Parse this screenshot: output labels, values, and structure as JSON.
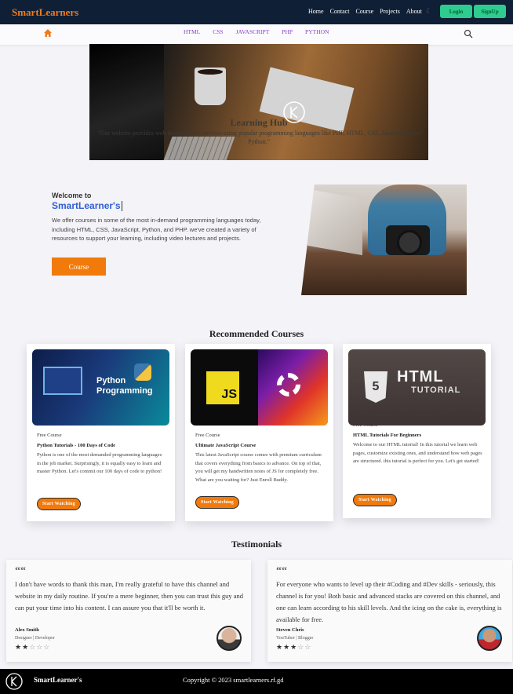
{
  "brand": "SmartLearners",
  "topnav": [
    "Home",
    "Contact",
    "Course",
    "Projects",
    "About"
  ],
  "auth": {
    "login": "Login",
    "signup": "SignUp"
  },
  "subnav": [
    "HTML",
    "CSS",
    "JAVASCRIPT",
    "PHP",
    "PYTHON"
  ],
  "hero": {
    "title": "Learning Hub",
    "subtitle": "\"Our website provides web development services using popular programming languages like PHP, HTML, CSS, JavaScript, and Python.\""
  },
  "welcome": {
    "heading": "Welcome to",
    "name": "SmartLearner's",
    "text": "We offer courses in some of the most in-demand programming languages today, including HTML, CSS, JavaScript, Python, and PHP. we've created a variety of resources to support your learning, including video lectures and projects.",
    "button": "Course"
  },
  "recommended": {
    "title": "Recommended Courses",
    "cards": [
      {
        "tag": "Free Course",
        "title": "Python Tutorials - 100 Days of Code",
        "text": "Python is one of the most demanded programming languages in the job market. Surprisingly, it is equally easy to learn and master Python. Let's commit our 100 days of code to python!",
        "button": "Start Watching",
        "image_text": [
          "Python",
          "Programming"
        ]
      },
      {
        "tag": "Free Course",
        "title": "Ultimate JavaScript Course",
        "text": "This latest JavaScript course comes with premium curriculum that covers everything from basics to advance. On top of that, you will get my handwritten notes of JS for completely free. What are you waiting for? Just Enroll Buddy.",
        "button": "Start Watching",
        "image_text": [
          "JS"
        ]
      },
      {
        "tag": "Free Course",
        "title": "HTML Tutorials For Beginners",
        "text": "Welcome to our HTML tutorial! In this tutorial we learn web pages, customize existing ones, and understand how web pages are structured. this tutorial is perfect for you. Let's get started!",
        "button": "Start Watching",
        "image_text": [
          "5",
          "HTML",
          "TUTORIAL"
        ]
      }
    ]
  },
  "testimonials": {
    "title": "Testimonials",
    "quote_mark": "““",
    "items": [
      {
        "text": "I don't have words to thank this man, I'm really grateful to have this channel and website in my daily routine. If you're a mere beginner, then you can trust this guy and can put your time into his content. I can assure you that it'll be worth it.",
        "name": "Alex Smith",
        "role": "Designer | Developer",
        "stars": 2,
        "stars_total": 5
      },
      {
        "text": "For everyone who wants to level up their #Coding and #Dev skills - seriously, this channel is for you! Both basic and advanced stacks are covered on this channel, and one can learn according to his skill levels. And the icing on the cake is, everything is available for free.",
        "name": "Steven Chris",
        "role": "YouTuber | Blogger",
        "stars": 3,
        "stars_total": 5
      }
    ]
  },
  "footer": {
    "brand": "SmartLearner's",
    "copyright": "Copyright © 2023 smartlearners.rf.gd"
  },
  "colors": {
    "accent": "#f27a0b",
    "navbar": "#0f1f35",
    "auth_button": "#2ecc8e",
    "link_purple": "#8a3fc8",
    "name_blue": "#2f5fd6"
  },
  "icons": [
    "home-icon",
    "search-icon",
    "moon-icon",
    "logo-icon",
    "quote-icon",
    "star-icon"
  ]
}
